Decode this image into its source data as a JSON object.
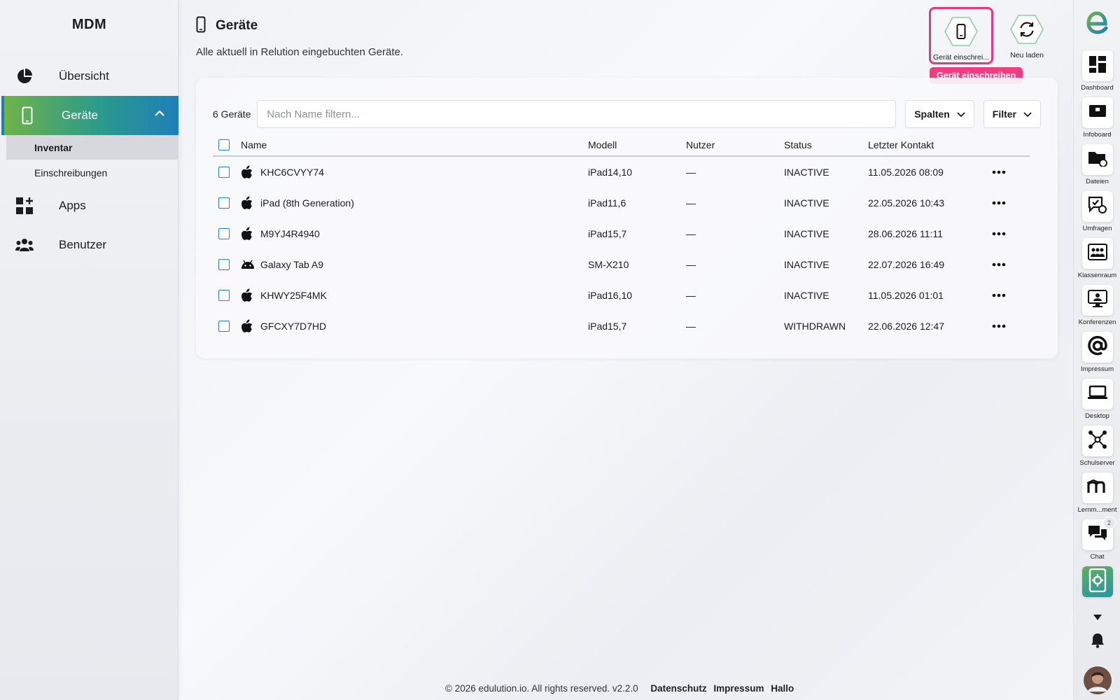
{
  "sidebar": {
    "title": "MDM",
    "items": [
      {
        "label": "Übersicht",
        "icon": "pie-chart-icon"
      },
      {
        "label": "Geräte",
        "icon": "smartphone-icon"
      },
      {
        "label": "Apps",
        "icon": "apps-grid-icon"
      },
      {
        "label": "Benutzer",
        "icon": "users-icon"
      }
    ],
    "sub_items": [
      {
        "label": "Inventar"
      },
      {
        "label": "Einschreibungen"
      }
    ]
  },
  "header": {
    "title": "Geräte",
    "subtitle": "Alle aktuell in Relution eingebuchten Geräte."
  },
  "actions": {
    "enroll_label": "Gerät einschrei...",
    "enroll_tooltip": "Gerät einschreiben",
    "reload_label": "Neu laden"
  },
  "toolbar": {
    "count": "6 Geräte",
    "filter_placeholder": "Nach Name filtern...",
    "columns_button": "Spalten",
    "filter_button": "Filter"
  },
  "table": {
    "headers": {
      "name": "Name",
      "model": "Modell",
      "user": "Nutzer",
      "status": "Status",
      "contact": "Letzter Kontakt"
    },
    "rows": [
      {
        "os": "apple",
        "name": "KHC6CVYY74",
        "model": "iPad14,10",
        "user": "—",
        "status": "INACTIVE",
        "contact": "11.05.2026 08:09"
      },
      {
        "os": "apple",
        "name": "iPad (8th Generation)",
        "model": "iPad11,6",
        "user": "—",
        "status": "INACTIVE",
        "contact": "22.05.2026 10:43"
      },
      {
        "os": "apple",
        "name": "M9YJ4R4940",
        "model": "iPad15,7",
        "user": "—",
        "status": "INACTIVE",
        "contact": "28.06.2026 11:11"
      },
      {
        "os": "android",
        "name": "Galaxy Tab A9",
        "model": "SM-X210",
        "user": "—",
        "status": "INACTIVE",
        "contact": "22.07.2026 16:49"
      },
      {
        "os": "apple",
        "name": "KHWY25F4MK",
        "model": "iPad16,10",
        "user": "—",
        "status": "INACTIVE",
        "contact": "11.05.2026 01:01"
      },
      {
        "os": "apple",
        "name": "GFCXY7D7HD",
        "model": "iPad15,7",
        "user": "—",
        "status": "WITHDRAWN",
        "contact": "22.06.2026 12:47"
      }
    ]
  },
  "dock": {
    "items": [
      {
        "label": "Dashboard",
        "icon": "dashboard-icon"
      },
      {
        "label": "Infoboard",
        "icon": "infoboard-icon"
      },
      {
        "label": "Dateien",
        "icon": "folder-icon"
      },
      {
        "label": "Umfragen",
        "icon": "survey-icon"
      },
      {
        "label": "Klassenraum",
        "icon": "classroom-icon"
      },
      {
        "label": "Konferenzen",
        "icon": "conference-icon"
      },
      {
        "label": "Impressum",
        "icon": "at-icon"
      },
      {
        "label": "Desktop",
        "icon": "laptop-icon"
      },
      {
        "label": "Schulserver",
        "icon": "network-icon"
      },
      {
        "label": "Lernm...ment",
        "icon": "moodle-icon"
      },
      {
        "label": "Chat",
        "icon": "chat-icon",
        "badge": "2"
      },
      {
        "label": "",
        "icon": "mdm-icon"
      }
    ]
  },
  "footer": {
    "copyright": "© 2026 edulution.io. All rights reserved. v2.2.0",
    "links": [
      "Datenschutz",
      "Impressum",
      "Hallo"
    ]
  },
  "colors": {
    "accent_gradient_start": "#6fb24a",
    "accent_gradient_end": "#1e7fb8",
    "tooltip_pink": "#ef3d83",
    "checkbox_blue": "#2b7fc7"
  }
}
